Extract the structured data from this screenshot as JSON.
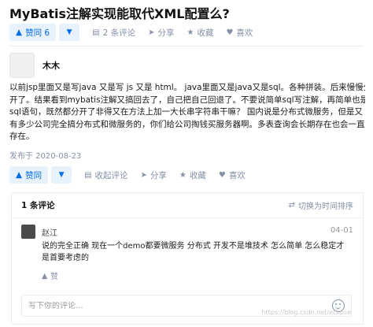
{
  "question": {
    "title": "MyBatis注解实现能取代XML配置么?"
  },
  "question_actions": {
    "upvote": "赞同 6",
    "comments": "2 条评论",
    "share": "分享",
    "favorite": "收藏",
    "like": "喜欢"
  },
  "answer": {
    "author": "木木",
    "content_lines": [
      "以前jsp里面又是写java 又是写 js 又是 html。 java里面又是java又是sql。各种拼装。后来慢慢分",
      "开了。结果看到mybatis注解又搞回去了，自己把自己回退了。不要说简单sql写注解，再简单也是",
      "sql语句，既然都分开了非得又在方法上加一大长串字符串干嘛？ 国内说是分布式微服务，但是又",
      "有多少公司完全搞分布式和微服务的，你们给公司掏钱买服务器啊。多表查询会长期存在也会一直",
      "存在。"
    ],
    "published": "发布于 2020-08-23"
  },
  "answer_actions": {
    "upvote": "赞同",
    "comments": "收起评论",
    "share": "分享",
    "favorite": "收藏",
    "like": "喜欢"
  },
  "comments": {
    "count": "1 条评论",
    "sort_toggle": "切换为时间排序",
    "items": [
      {
        "user": "赵江",
        "date": "04-01",
        "lines": [
          "说的完全正确 现在一个demo都要微服务 分布式 开发不是堆技术 怎么简单 怎么稳定才",
          "是首要考虑的"
        ],
        "like": "赞"
      }
    ],
    "input_placeholder": "写下你的评论..."
  },
  "watermark": "https://blog.csdn.net/eclipse"
}
